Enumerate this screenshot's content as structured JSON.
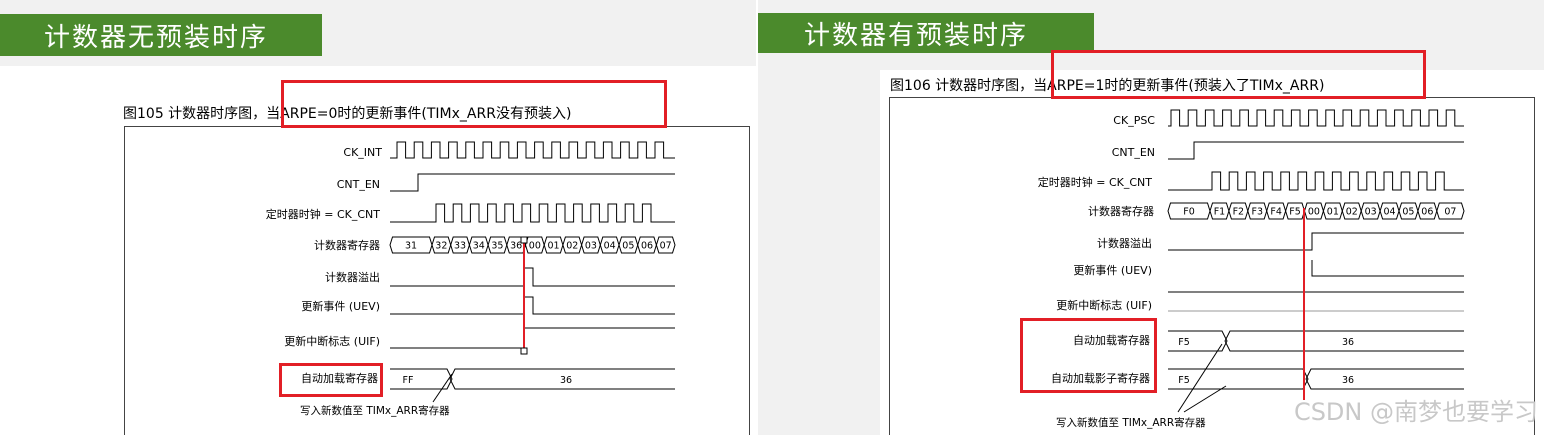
{
  "left": {
    "title": "计数器无预装时序",
    "caption": "图105    计数器时序图，当ARPE=0时的更新事件(TIMx_ARR没有预装入)",
    "signals": {
      "ck": "CK_INT",
      "en": "CNT_EN",
      "clk": "定时器时钟 = CK_CNT",
      "counter": "计数器寄存器",
      "overflow": "计数器溢出",
      "uev": "更新事件 (UEV)",
      "uif": "更新中断标志 (UIF)",
      "arr": "自动加载寄存器"
    },
    "counter_values": [
      "31",
      "32",
      "33",
      "34",
      "35",
      "36",
      "00",
      "01",
      "02",
      "03",
      "04",
      "05",
      "06",
      "07"
    ],
    "arr_values": [
      "FF",
      "36"
    ],
    "note": "写入新数值至 TIMx_ARR寄存器"
  },
  "right": {
    "title": "计数器有预装时序",
    "caption": "图106    计数器时序图，当ARPE=1时的更新事件(预装入了TIMx_ARR)",
    "signals": {
      "ck": "CK_PSC",
      "en": "CNT_EN",
      "clk": "定时器时钟 = CK_CNT",
      "counter": "计数器寄存器",
      "overflow": "计数器溢出",
      "uev": "更新事件 (UEV)",
      "uif": "更新中断标志 (UIF)",
      "arr": "自动加载寄存器",
      "shadow": "自动加载影子寄存器"
    },
    "counter_values": [
      "F0",
      "F1",
      "F2",
      "F3",
      "F4",
      "F5",
      "00",
      "01",
      "02",
      "03",
      "04",
      "05",
      "06",
      "07"
    ],
    "arr_values": [
      "F5",
      "36"
    ],
    "shadow_values": [
      "F5",
      "36"
    ],
    "note": "写入新数值至 TIMx_ARR寄存器"
  },
  "watermark": "CSDN @南梦也要学习",
  "colors": {
    "title_bg": "#4b8a2c",
    "highlight": "#e21f26"
  }
}
